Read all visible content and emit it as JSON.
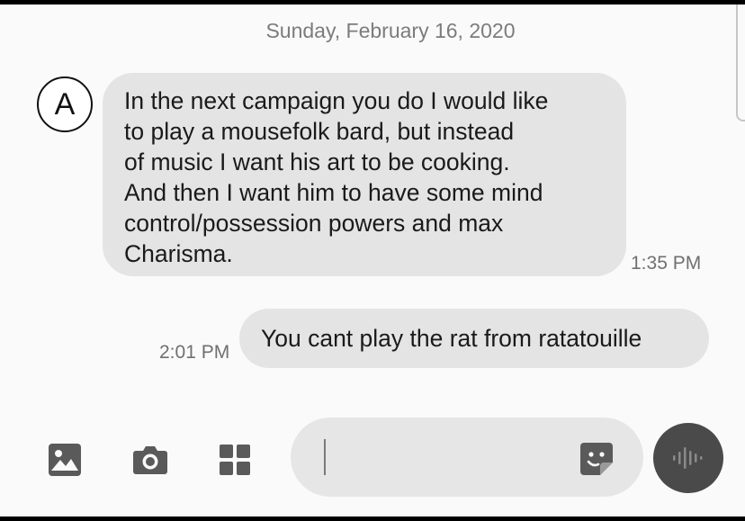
{
  "conversation": {
    "date_header": "Sunday, February 16, 2020",
    "contact": {
      "avatar_letter": "A"
    },
    "messages": [
      {
        "direction": "incoming",
        "lines": [
          "In the next campaign you do I would like",
          "to play a mousefolk bard, but instead",
          "of music I want his art to be cooking.",
          "And then I want him to have some mind",
          "control/possession powers and max",
          "Charisma."
        ],
        "time": "1:35 PM"
      },
      {
        "direction": "outgoing",
        "text": "You cant play the rat from ratatouille",
        "time": "2:01 PM"
      }
    ]
  },
  "composer": {
    "input_value": "",
    "icons": {
      "gallery": "image-gallery-icon",
      "camera": "camera-icon",
      "apps": "apps-grid-icon",
      "sticker": "sticker-icon",
      "voice": "voice-waveform-icon"
    }
  },
  "colors": {
    "background": "#fafafa",
    "bubble": "#e4e4e4",
    "timestamp": "#707070",
    "icon": "#5a5a5a",
    "voice_button": "#4a4a4a"
  }
}
